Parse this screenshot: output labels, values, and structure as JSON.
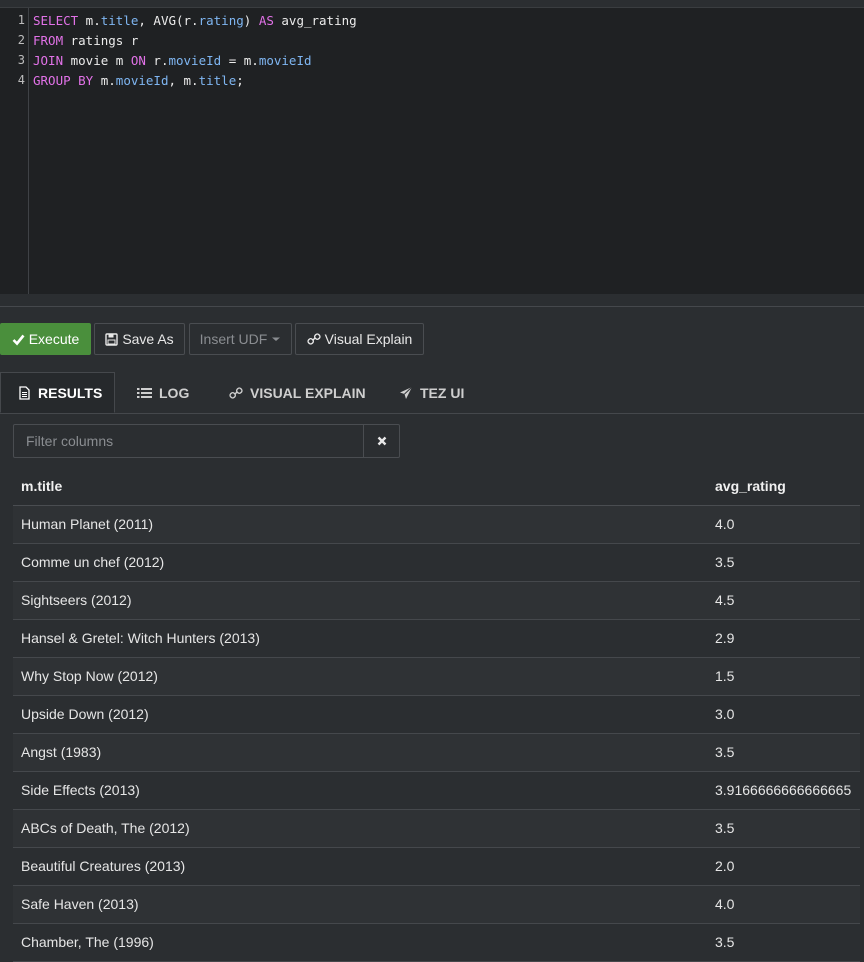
{
  "editor": {
    "line_numbers": [
      "1",
      "2",
      "3",
      "4"
    ],
    "line1": {
      "kw1": "SELECT",
      "t1": " m.",
      "f1": "title",
      "t2": ", AVG(r.",
      "f2": "rating",
      "t3": ") ",
      "kw2": "AS",
      "t4": " avg_rating"
    },
    "line2": {
      "kw1": "FROM",
      "t1": " ratings r"
    },
    "line3": {
      "kw1": "JOIN",
      "t1": " movie m ",
      "kw2": "ON",
      "t2": " r.",
      "f1": "movieId",
      "t3": " = m.",
      "f2": "movieId"
    },
    "line4": {
      "kw1": "GROUP BY",
      "t1": " m.",
      "f1": "movieId",
      "t2": ", m.",
      "f2": "title",
      "t3": ";"
    }
  },
  "toolbar": {
    "execute_label": "Execute",
    "save_as_label": "Save As",
    "insert_udf_label": "Insert UDF",
    "visual_explain_label": "Visual Explain"
  },
  "tabs": [
    {
      "label": "RESULTS",
      "active": true
    },
    {
      "label": "LOG",
      "active": false
    },
    {
      "label": "VISUAL EXPLAIN",
      "active": false
    },
    {
      "label": "TEZ UI",
      "active": false
    }
  ],
  "filter": {
    "placeholder": "Filter columns",
    "value": ""
  },
  "table": {
    "columns": [
      "m.title",
      "avg_rating"
    ],
    "rows": [
      [
        "Human Planet (2011)",
        "4.0"
      ],
      [
        "Comme un chef (2012)",
        "3.5"
      ],
      [
        "Sightseers (2012)",
        "4.5"
      ],
      [
        "Hansel & Gretel: Witch Hunters (2013)",
        "2.9"
      ],
      [
        "Why Stop Now (2012)",
        "1.5"
      ],
      [
        "Upside Down (2012)",
        "3.0"
      ],
      [
        "Angst (1983)",
        "3.5"
      ],
      [
        "Side Effects (2013)",
        "3.9166666666666665"
      ],
      [
        "ABCs of Death, The (2012)",
        "3.5"
      ],
      [
        "Beautiful Creatures (2013)",
        "2.0"
      ],
      [
        "Safe Haven (2013)",
        "4.0"
      ],
      [
        "Chamber, The (1996)",
        "3.5"
      ]
    ]
  },
  "colors": {
    "execute_bg": "#4a8f3c",
    "keyword": "#e272e8",
    "identifier": "#7fb6f2",
    "page_bg": "#2b2e31"
  },
  "icons": {
    "execute": "check-icon",
    "save_as": "floppy-icon",
    "insert_udf": "caret-down-icon",
    "visual_explain": "link-icon",
    "results": "file-icon",
    "log": "list-icon",
    "visual_explain_tab": "link-icon",
    "tez_ui": "paper-plane-icon",
    "filter_clear": "close-icon"
  }
}
